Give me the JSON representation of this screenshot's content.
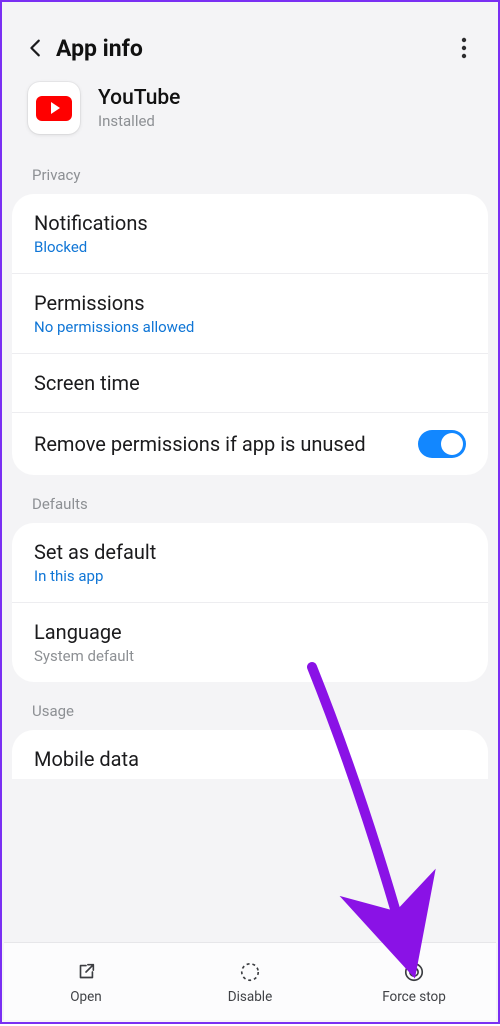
{
  "header": {
    "title": "App info"
  },
  "app": {
    "name": "YouTube",
    "status": "Installed"
  },
  "sections": {
    "privacy": "Privacy",
    "defaults": "Defaults",
    "usage": "Usage"
  },
  "privacy": {
    "notifications": {
      "label": "Notifications",
      "sub": "Blocked"
    },
    "permissions": {
      "label": "Permissions",
      "sub": "No permissions allowed"
    },
    "screentime": {
      "label": "Screen time"
    },
    "remove": {
      "label": "Remove permissions if app is unused"
    }
  },
  "defaults": {
    "setdefault": {
      "label": "Set as default",
      "sub": "In this app"
    },
    "language": {
      "label": "Language",
      "sub": "System default"
    }
  },
  "usage": {
    "mobiledata": {
      "label": "Mobile data"
    }
  },
  "bottom": {
    "open": "Open",
    "disable": "Disable",
    "force": "Force stop"
  },
  "colors": {
    "accent": "#1287ff",
    "link": "#1076d6",
    "annotation": "#8a12e6"
  }
}
